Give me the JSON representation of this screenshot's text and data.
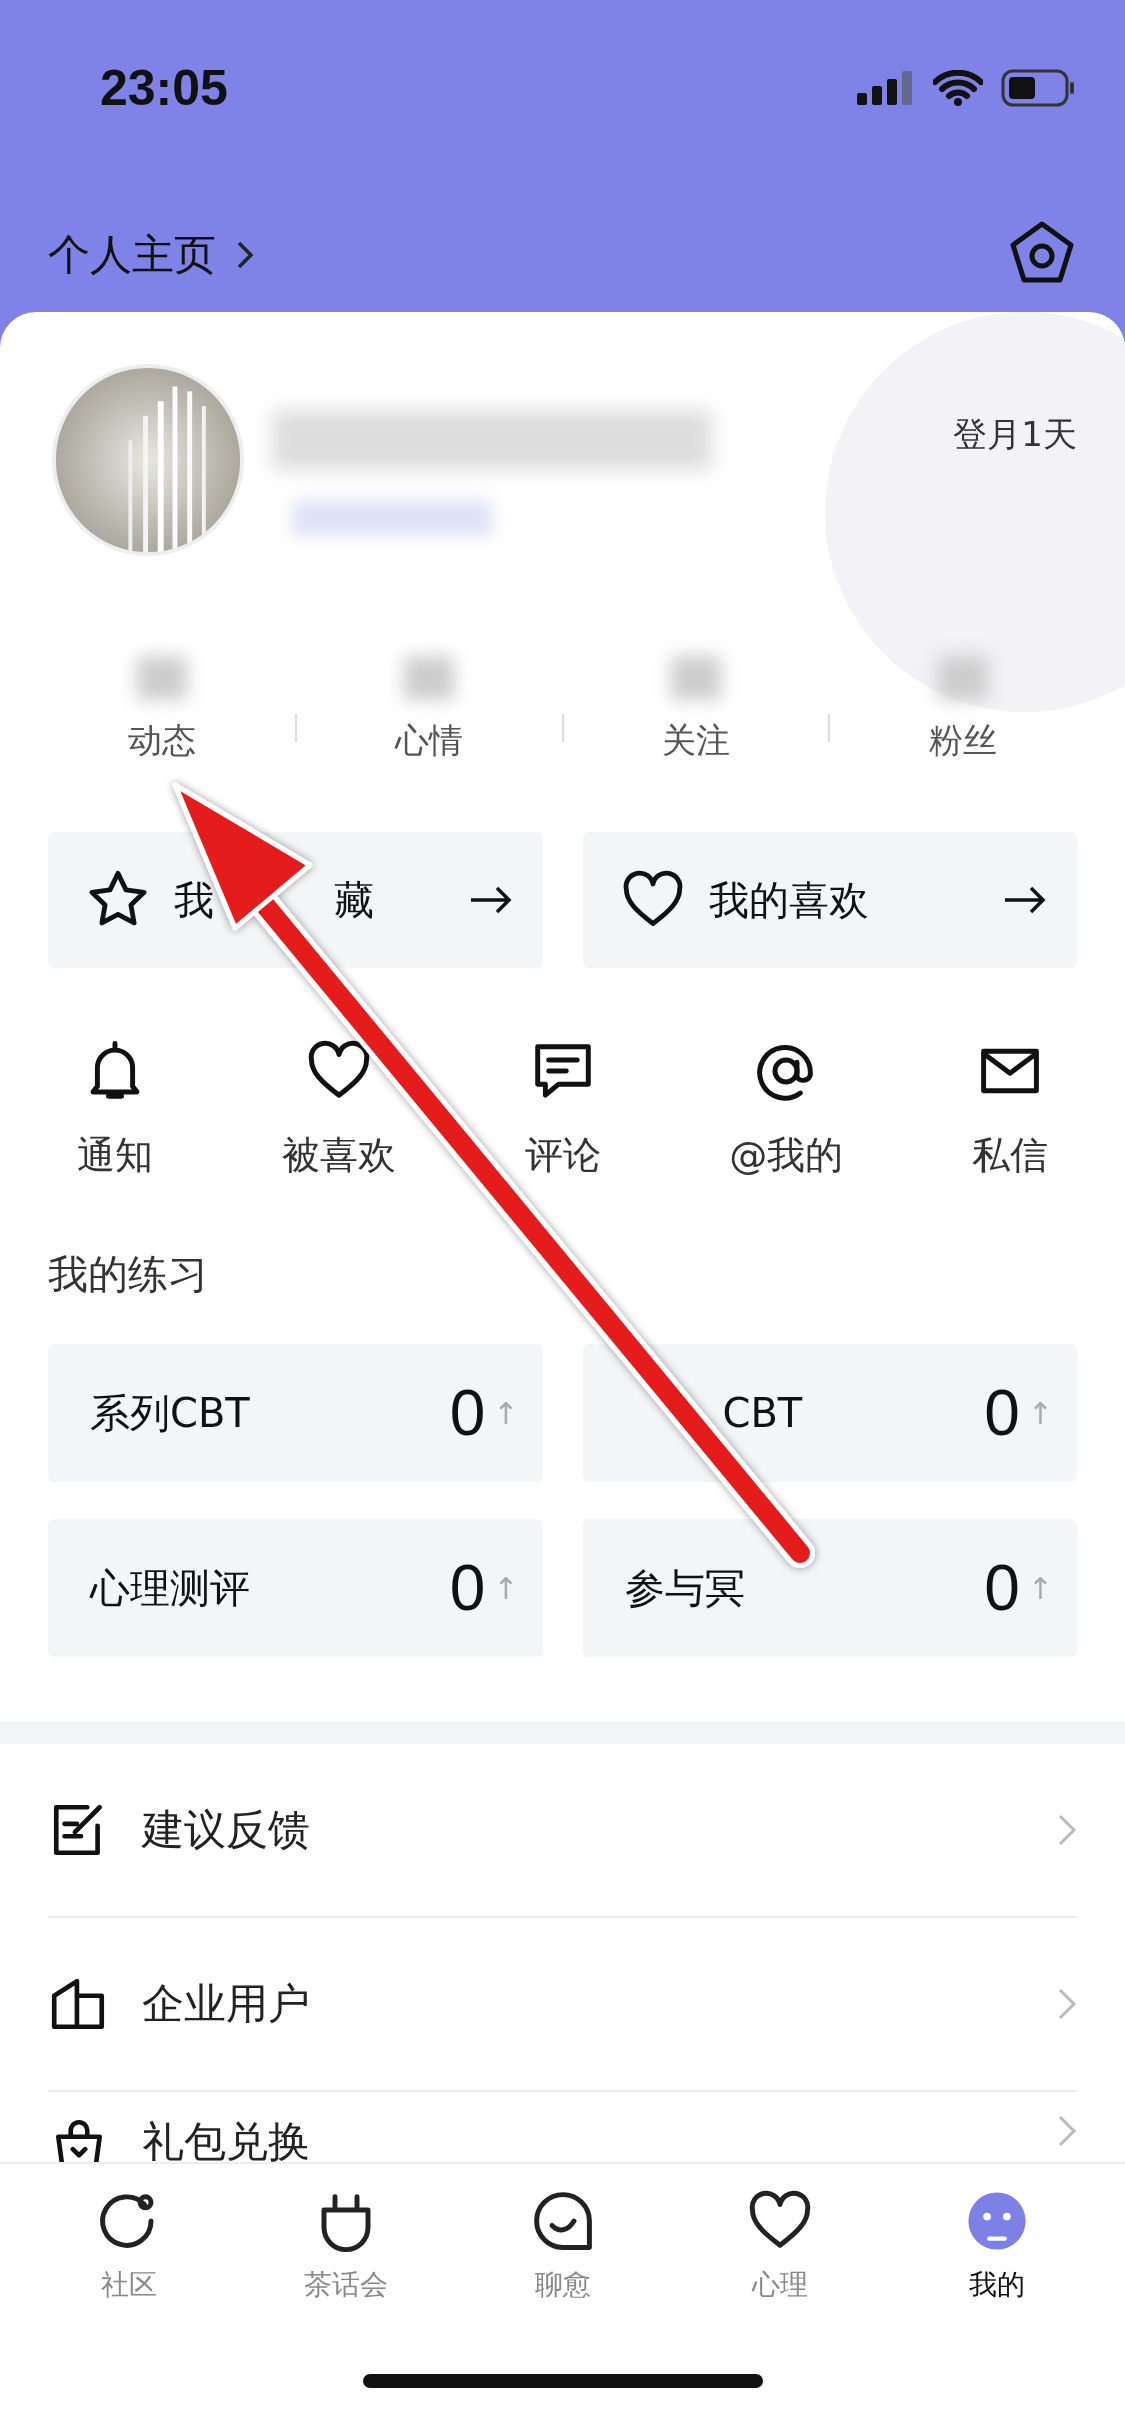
{
  "status_bar": {
    "time": "23:05"
  },
  "header": {
    "title": "个人主页"
  },
  "profile": {
    "badge": "登月1天"
  },
  "stats": [
    {
      "label": "动态"
    },
    {
      "label": "心情"
    },
    {
      "label": "关注"
    },
    {
      "label": "粉丝"
    }
  ],
  "shortcuts": [
    {
      "label": "我",
      "label_end": "藏"
    },
    {
      "label": "我的喜欢"
    }
  ],
  "actions": [
    {
      "label": "通知"
    },
    {
      "label": "被喜欢"
    },
    {
      "label": "评论"
    },
    {
      "label": "@我的"
    },
    {
      "label": "私信"
    }
  ],
  "practice": {
    "title": "我的练习",
    "items": [
      {
        "label": "系列CBT",
        "count": "0",
        "trend": "↑"
      },
      {
        "label": "CBT",
        "count": "0",
        "trend": "↑",
        "covered_start": true
      },
      {
        "label": "心理测评",
        "count": "0",
        "trend": "↑"
      },
      {
        "label": "参与冥",
        "count": "0",
        "trend": "↑"
      }
    ]
  },
  "menu": [
    {
      "label": "建议反馈"
    },
    {
      "label": "企业用户"
    },
    {
      "label": "礼包兑换"
    }
  ],
  "tab_bar": [
    {
      "label": "社区",
      "selected": false
    },
    {
      "label": "茶话会",
      "selected": false
    },
    {
      "label": "聊愈",
      "selected": false
    },
    {
      "label": "心理",
      "selected": false
    },
    {
      "label": "我的",
      "selected": true
    }
  ]
}
